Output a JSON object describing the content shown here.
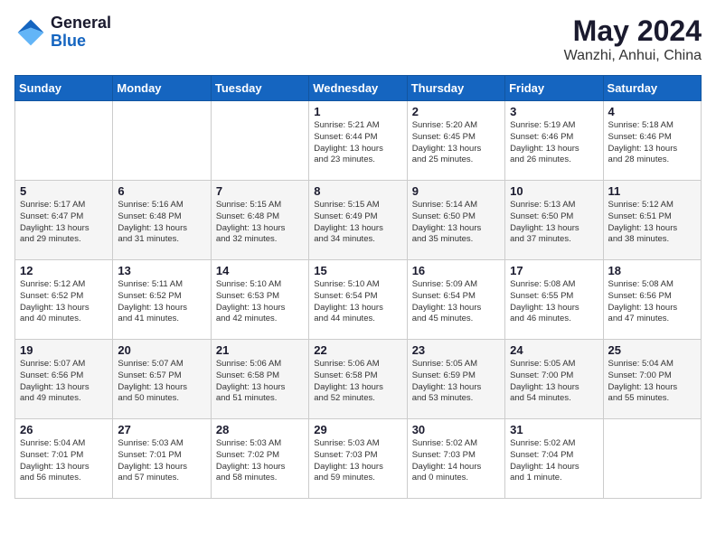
{
  "header": {
    "logo_general": "General",
    "logo_blue": "Blue",
    "month_title": "May 2024",
    "location": "Wanzhi, Anhui, China"
  },
  "weekdays": [
    "Sunday",
    "Monday",
    "Tuesday",
    "Wednesday",
    "Thursday",
    "Friday",
    "Saturday"
  ],
  "weeks": [
    [
      {
        "day": "",
        "info": ""
      },
      {
        "day": "",
        "info": ""
      },
      {
        "day": "",
        "info": ""
      },
      {
        "day": "1",
        "info": "Sunrise: 5:21 AM\nSunset: 6:44 PM\nDaylight: 13 hours\nand 23 minutes."
      },
      {
        "day": "2",
        "info": "Sunrise: 5:20 AM\nSunset: 6:45 PM\nDaylight: 13 hours\nand 25 minutes."
      },
      {
        "day": "3",
        "info": "Sunrise: 5:19 AM\nSunset: 6:46 PM\nDaylight: 13 hours\nand 26 minutes."
      },
      {
        "day": "4",
        "info": "Sunrise: 5:18 AM\nSunset: 6:46 PM\nDaylight: 13 hours\nand 28 minutes."
      }
    ],
    [
      {
        "day": "5",
        "info": "Sunrise: 5:17 AM\nSunset: 6:47 PM\nDaylight: 13 hours\nand 29 minutes."
      },
      {
        "day": "6",
        "info": "Sunrise: 5:16 AM\nSunset: 6:48 PM\nDaylight: 13 hours\nand 31 minutes."
      },
      {
        "day": "7",
        "info": "Sunrise: 5:15 AM\nSunset: 6:48 PM\nDaylight: 13 hours\nand 32 minutes."
      },
      {
        "day": "8",
        "info": "Sunrise: 5:15 AM\nSunset: 6:49 PM\nDaylight: 13 hours\nand 34 minutes."
      },
      {
        "day": "9",
        "info": "Sunrise: 5:14 AM\nSunset: 6:50 PM\nDaylight: 13 hours\nand 35 minutes."
      },
      {
        "day": "10",
        "info": "Sunrise: 5:13 AM\nSunset: 6:50 PM\nDaylight: 13 hours\nand 37 minutes."
      },
      {
        "day": "11",
        "info": "Sunrise: 5:12 AM\nSunset: 6:51 PM\nDaylight: 13 hours\nand 38 minutes."
      }
    ],
    [
      {
        "day": "12",
        "info": "Sunrise: 5:12 AM\nSunset: 6:52 PM\nDaylight: 13 hours\nand 40 minutes."
      },
      {
        "day": "13",
        "info": "Sunrise: 5:11 AM\nSunset: 6:52 PM\nDaylight: 13 hours\nand 41 minutes."
      },
      {
        "day": "14",
        "info": "Sunrise: 5:10 AM\nSunset: 6:53 PM\nDaylight: 13 hours\nand 42 minutes."
      },
      {
        "day": "15",
        "info": "Sunrise: 5:10 AM\nSunset: 6:54 PM\nDaylight: 13 hours\nand 44 minutes."
      },
      {
        "day": "16",
        "info": "Sunrise: 5:09 AM\nSunset: 6:54 PM\nDaylight: 13 hours\nand 45 minutes."
      },
      {
        "day": "17",
        "info": "Sunrise: 5:08 AM\nSunset: 6:55 PM\nDaylight: 13 hours\nand 46 minutes."
      },
      {
        "day": "18",
        "info": "Sunrise: 5:08 AM\nSunset: 6:56 PM\nDaylight: 13 hours\nand 47 minutes."
      }
    ],
    [
      {
        "day": "19",
        "info": "Sunrise: 5:07 AM\nSunset: 6:56 PM\nDaylight: 13 hours\nand 49 minutes."
      },
      {
        "day": "20",
        "info": "Sunrise: 5:07 AM\nSunset: 6:57 PM\nDaylight: 13 hours\nand 50 minutes."
      },
      {
        "day": "21",
        "info": "Sunrise: 5:06 AM\nSunset: 6:58 PM\nDaylight: 13 hours\nand 51 minutes."
      },
      {
        "day": "22",
        "info": "Sunrise: 5:06 AM\nSunset: 6:58 PM\nDaylight: 13 hours\nand 52 minutes."
      },
      {
        "day": "23",
        "info": "Sunrise: 5:05 AM\nSunset: 6:59 PM\nDaylight: 13 hours\nand 53 minutes."
      },
      {
        "day": "24",
        "info": "Sunrise: 5:05 AM\nSunset: 7:00 PM\nDaylight: 13 hours\nand 54 minutes."
      },
      {
        "day": "25",
        "info": "Sunrise: 5:04 AM\nSunset: 7:00 PM\nDaylight: 13 hours\nand 55 minutes."
      }
    ],
    [
      {
        "day": "26",
        "info": "Sunrise: 5:04 AM\nSunset: 7:01 PM\nDaylight: 13 hours\nand 56 minutes."
      },
      {
        "day": "27",
        "info": "Sunrise: 5:03 AM\nSunset: 7:01 PM\nDaylight: 13 hours\nand 57 minutes."
      },
      {
        "day": "28",
        "info": "Sunrise: 5:03 AM\nSunset: 7:02 PM\nDaylight: 13 hours\nand 58 minutes."
      },
      {
        "day": "29",
        "info": "Sunrise: 5:03 AM\nSunset: 7:03 PM\nDaylight: 13 hours\nand 59 minutes."
      },
      {
        "day": "30",
        "info": "Sunrise: 5:02 AM\nSunset: 7:03 PM\nDaylight: 14 hours\nand 0 minutes."
      },
      {
        "day": "31",
        "info": "Sunrise: 5:02 AM\nSunset: 7:04 PM\nDaylight: 14 hours\nand 1 minute."
      },
      {
        "day": "",
        "info": ""
      }
    ]
  ]
}
